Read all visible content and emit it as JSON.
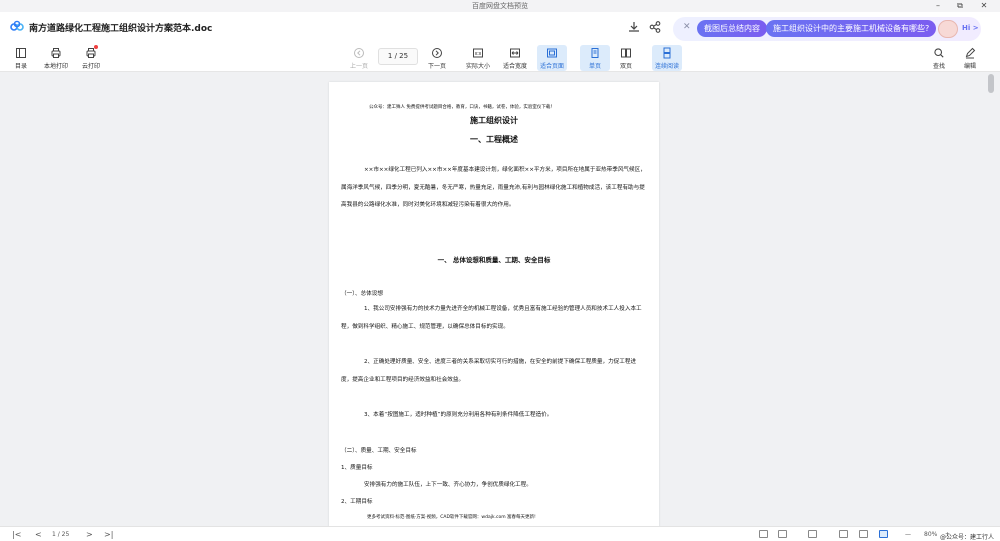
{
  "window": {
    "title": "百度网盘文档预览",
    "min": "–",
    "restore": "⧉",
    "close": "✕"
  },
  "doc": {
    "title": "南方道路绿化工程施工组织设计方案范本.doc"
  },
  "ai_banner": {
    "chip1": "截图后总结内容",
    "chip2": "施工组织设计中的主要施工机械设备有哪些?",
    "hi": "Hi >"
  },
  "toolbar": {
    "catalog": "目录",
    "local_print": "本地打印",
    "cloud_print": "云打印",
    "prev_page": "上一页",
    "page_indicator": "1  /  25",
    "next_page": "下一页",
    "actual_size": "实际大小",
    "fit_width": "适合宽度",
    "fit_page": "适合页面",
    "single_page": "单页",
    "double_page": "双页",
    "continuous": "连续阅读",
    "find": "查找",
    "edit": "编辑"
  },
  "page": {
    "notice": "公众号：建工殊人   免费提供考试题目合格，教育，口诀，书籍，试卷，体验，实验室仪下载！",
    "title": "施工组织设计",
    "section1": "一、工程概述",
    "para1": "××市××绿化工程已列入××市××年度基本建设计划，绿化面积××平方米，项目所在地属于亚热带季风气候区，属海洋季风气候，四季分明，夏无酷暑，冬无严寒，热量充足，雨量充沛,有利与园林绿化施工和植物成活，该工程有助与提高我县的公路绿化水准，同时对美化环境和减轻污染有着很大的作用。",
    "section2": "一、 总体设想和质量、工期、安全目标",
    "sub1": "（一）、总体设想",
    "p_1": "1、我公司安排强有力的技术力量先进齐全的机械工程设备，优秀且富有施工经验的管理人员和技术工人投入本工程，做到科学组织、精心施工、规范管理，以确保总体目标的实现。",
    "p_2": "2、正确处理好质量、安全、进度三者的关系采取切实可行的措施，在安全的前提下确保工程质量，力促工程进度，提高企业和工程项目的经济效益和社会效益。",
    "p_3": "3、本着“按图施工，适时种植”的原则充分利用各种有利条件降低工程造价。",
    "sub2": "（二）、质量、工期、安全目标",
    "item1": "1、质量目标",
    "item1_text": "安排强有力的施工队伍，上下一致、齐心协力，争创优质绿化工程。",
    "item2": "2、工期目标",
    "footnote": "更多考试资料·标范·图纸·方案·视频，CAD软件下载官网：wdajk.com 富春每天更新!"
  },
  "bottombar": {
    "first": "|<",
    "prev": "<",
    "page": "1  /  25",
    "next": ">",
    "last": ">|",
    "zoom_out": "—",
    "zoom": "80%",
    "zoom_in": "+",
    "watermark": "@公众号：建工行人"
  }
}
